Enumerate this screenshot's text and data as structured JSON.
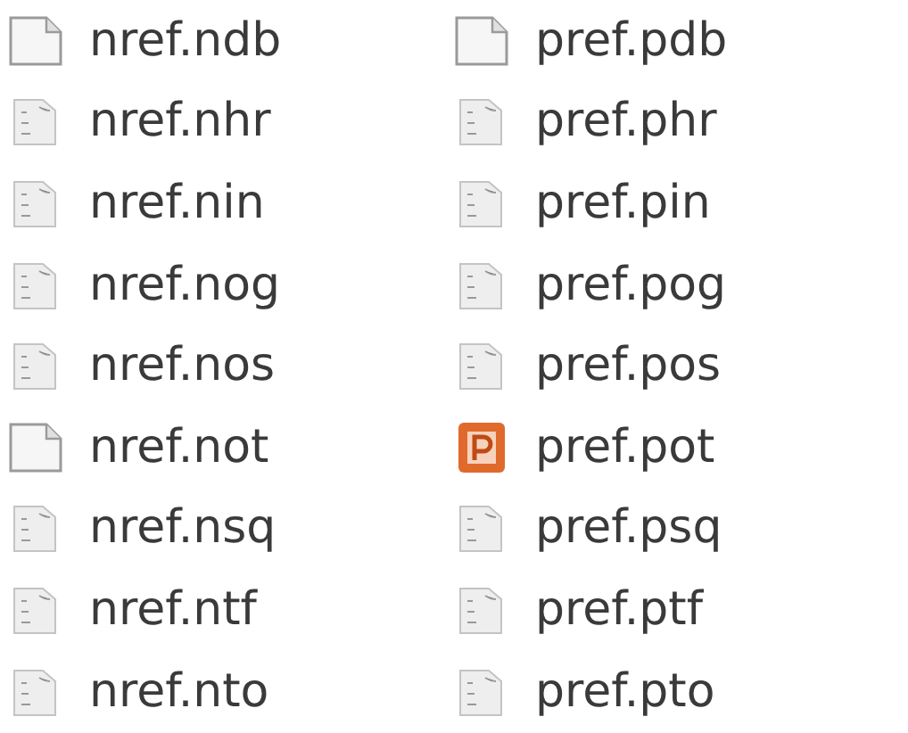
{
  "columns": [
    {
      "files": [
        {
          "name": "nref.ndb",
          "kind": "blank"
        },
        {
          "name": "nref.nhr",
          "kind": "text"
        },
        {
          "name": "nref.nin",
          "kind": "text"
        },
        {
          "name": "nref.nog",
          "kind": "text"
        },
        {
          "name": "nref.nos",
          "kind": "text"
        },
        {
          "name": "nref.not",
          "kind": "blank"
        },
        {
          "name": "nref.nsq",
          "kind": "text"
        },
        {
          "name": "nref.ntf",
          "kind": "text"
        },
        {
          "name": "nref.nto",
          "kind": "text"
        }
      ]
    },
    {
      "files": [
        {
          "name": "pref.pdb",
          "kind": "blank"
        },
        {
          "name": "pref.phr",
          "kind": "text"
        },
        {
          "name": "pref.pin",
          "kind": "text"
        },
        {
          "name": "pref.pog",
          "kind": "text"
        },
        {
          "name": "pref.pos",
          "kind": "text"
        },
        {
          "name": "pref.pot",
          "kind": "slides"
        },
        {
          "name": "pref.psq",
          "kind": "text"
        },
        {
          "name": "pref.ptf",
          "kind": "text"
        },
        {
          "name": "pref.pto",
          "kind": "text"
        }
      ]
    }
  ]
}
